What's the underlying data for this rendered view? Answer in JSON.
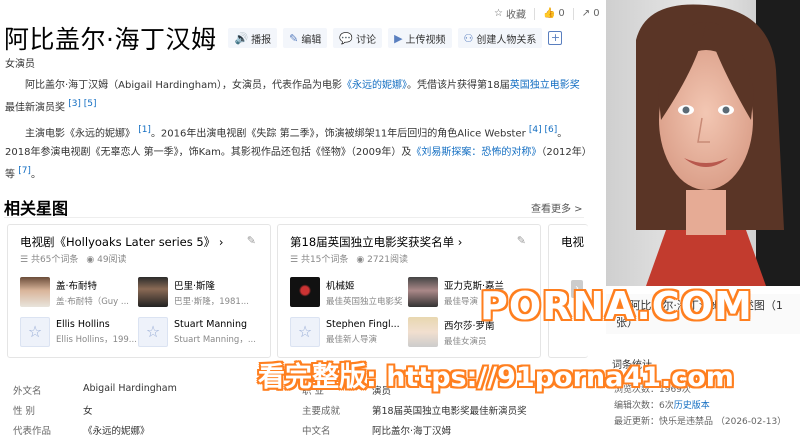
{
  "top_actions": {
    "favorite": "收藏",
    "like_count": "0",
    "share_count": "0"
  },
  "entry": {
    "title": "阿比盖尔·海丁汉姆",
    "buttons": [
      "播报",
      "编辑",
      "讨论",
      "上传视频",
      "创建人物关系"
    ],
    "subtitle": "女演员"
  },
  "summary": {
    "p1_text": "阿比盖尔·海丁汉姆（Abigail Hardingham），女演员，代表作品为电影",
    "p1_link1": "《永远的妮娜》",
    "p1_mid": "。凭借该片获得第18届",
    "p1_link2": "英国独立电影奖",
    "p1_end": "最佳新演员奖",
    "p1_refs": "[3] [5]",
    "p2_text_a": "主演电影《永远的妮娜》",
    "p2_ref1": "[1]",
    "p2_text_b": "。2016年出演电视剧《失踪 第二季》，饰演被绑架11年后回归的角色Alice Webster",
    "p2_ref2": "[4] [6]",
    "p2_text_c": "。2018年参演电视剧《无辜恋人 第一季》，饰Kam。其影视作品还包括《怪物》（2009年）及",
    "p2_link": "《刘易斯探案：恐怖的对称》",
    "p2_text_d": "（2012年）等",
    "p2_ref3": "[7]",
    "p2_end": "。"
  },
  "related": {
    "title": "相关星图",
    "see_more": "查看更多 >",
    "cards": [
      {
        "title": "电视剧《Hollyoaks Later series 5》",
        "items_count": "共65个词条",
        "reads": "49阅读",
        "people": [
          {
            "name": "盖·布耐特",
            "desc": "盖·布耐特（Guy ..."
          },
          {
            "name": "巴里·斯隆",
            "desc": "巴里·斯隆，1981..."
          },
          {
            "name": "Ellis Hollins",
            "desc": "Ellis Hollins，199..."
          },
          {
            "name": "Stuart Manning",
            "desc": "Stuart Manning，..."
          }
        ]
      },
      {
        "title": "第18届英国独立电影奖获奖名单",
        "items_count": "共15个词条",
        "reads": "2721阅读",
        "people": [
          {
            "name": "机械姬",
            "desc": "最佳英国独立电影奖"
          },
          {
            "name": "亚力克斯·嘉兰",
            "desc": "最佳导演"
          },
          {
            "name": "Stephen Fingl...",
            "desc": "最佳新人导演"
          },
          {
            "name": "西尔莎·罗南",
            "desc": "最佳女演员"
          }
        ]
      },
      {
        "title": "电视"
      }
    ]
  },
  "basic_info": [
    {
      "k1": "外文名",
      "v1": "Abigail Hardingham",
      "k2": "职    业",
      "v2": "演员"
    },
    {
      "k1": "性    别",
      "v1": "女",
      "k2": "主要成就",
      "v2": "第18届英国独立电影奖最佳新演员奖"
    },
    {
      "k1": "代表作品",
      "v1": "《永远的妮娜》",
      "k2": "中文名",
      "v2": "阿比盖尔·海丁汉姆"
    }
  ],
  "photo": {
    "caption": "阿比盖尔·海丁汉姆的概述图（1张）"
  },
  "stats": {
    "title": "词条统计",
    "views": "浏览次数：1969次",
    "edits_label": "编辑次数：6次",
    "history_link": "历史版本",
    "updated": "最近更新：快乐是违禁品  （2026-02-13）"
  },
  "watermark": {
    "line1": "PORNA.COM",
    "line2": "看完整版: https://91porna41.com"
  },
  "colors": {
    "link": "#136ec2",
    "watermark_orange": "#ff7f1f"
  }
}
